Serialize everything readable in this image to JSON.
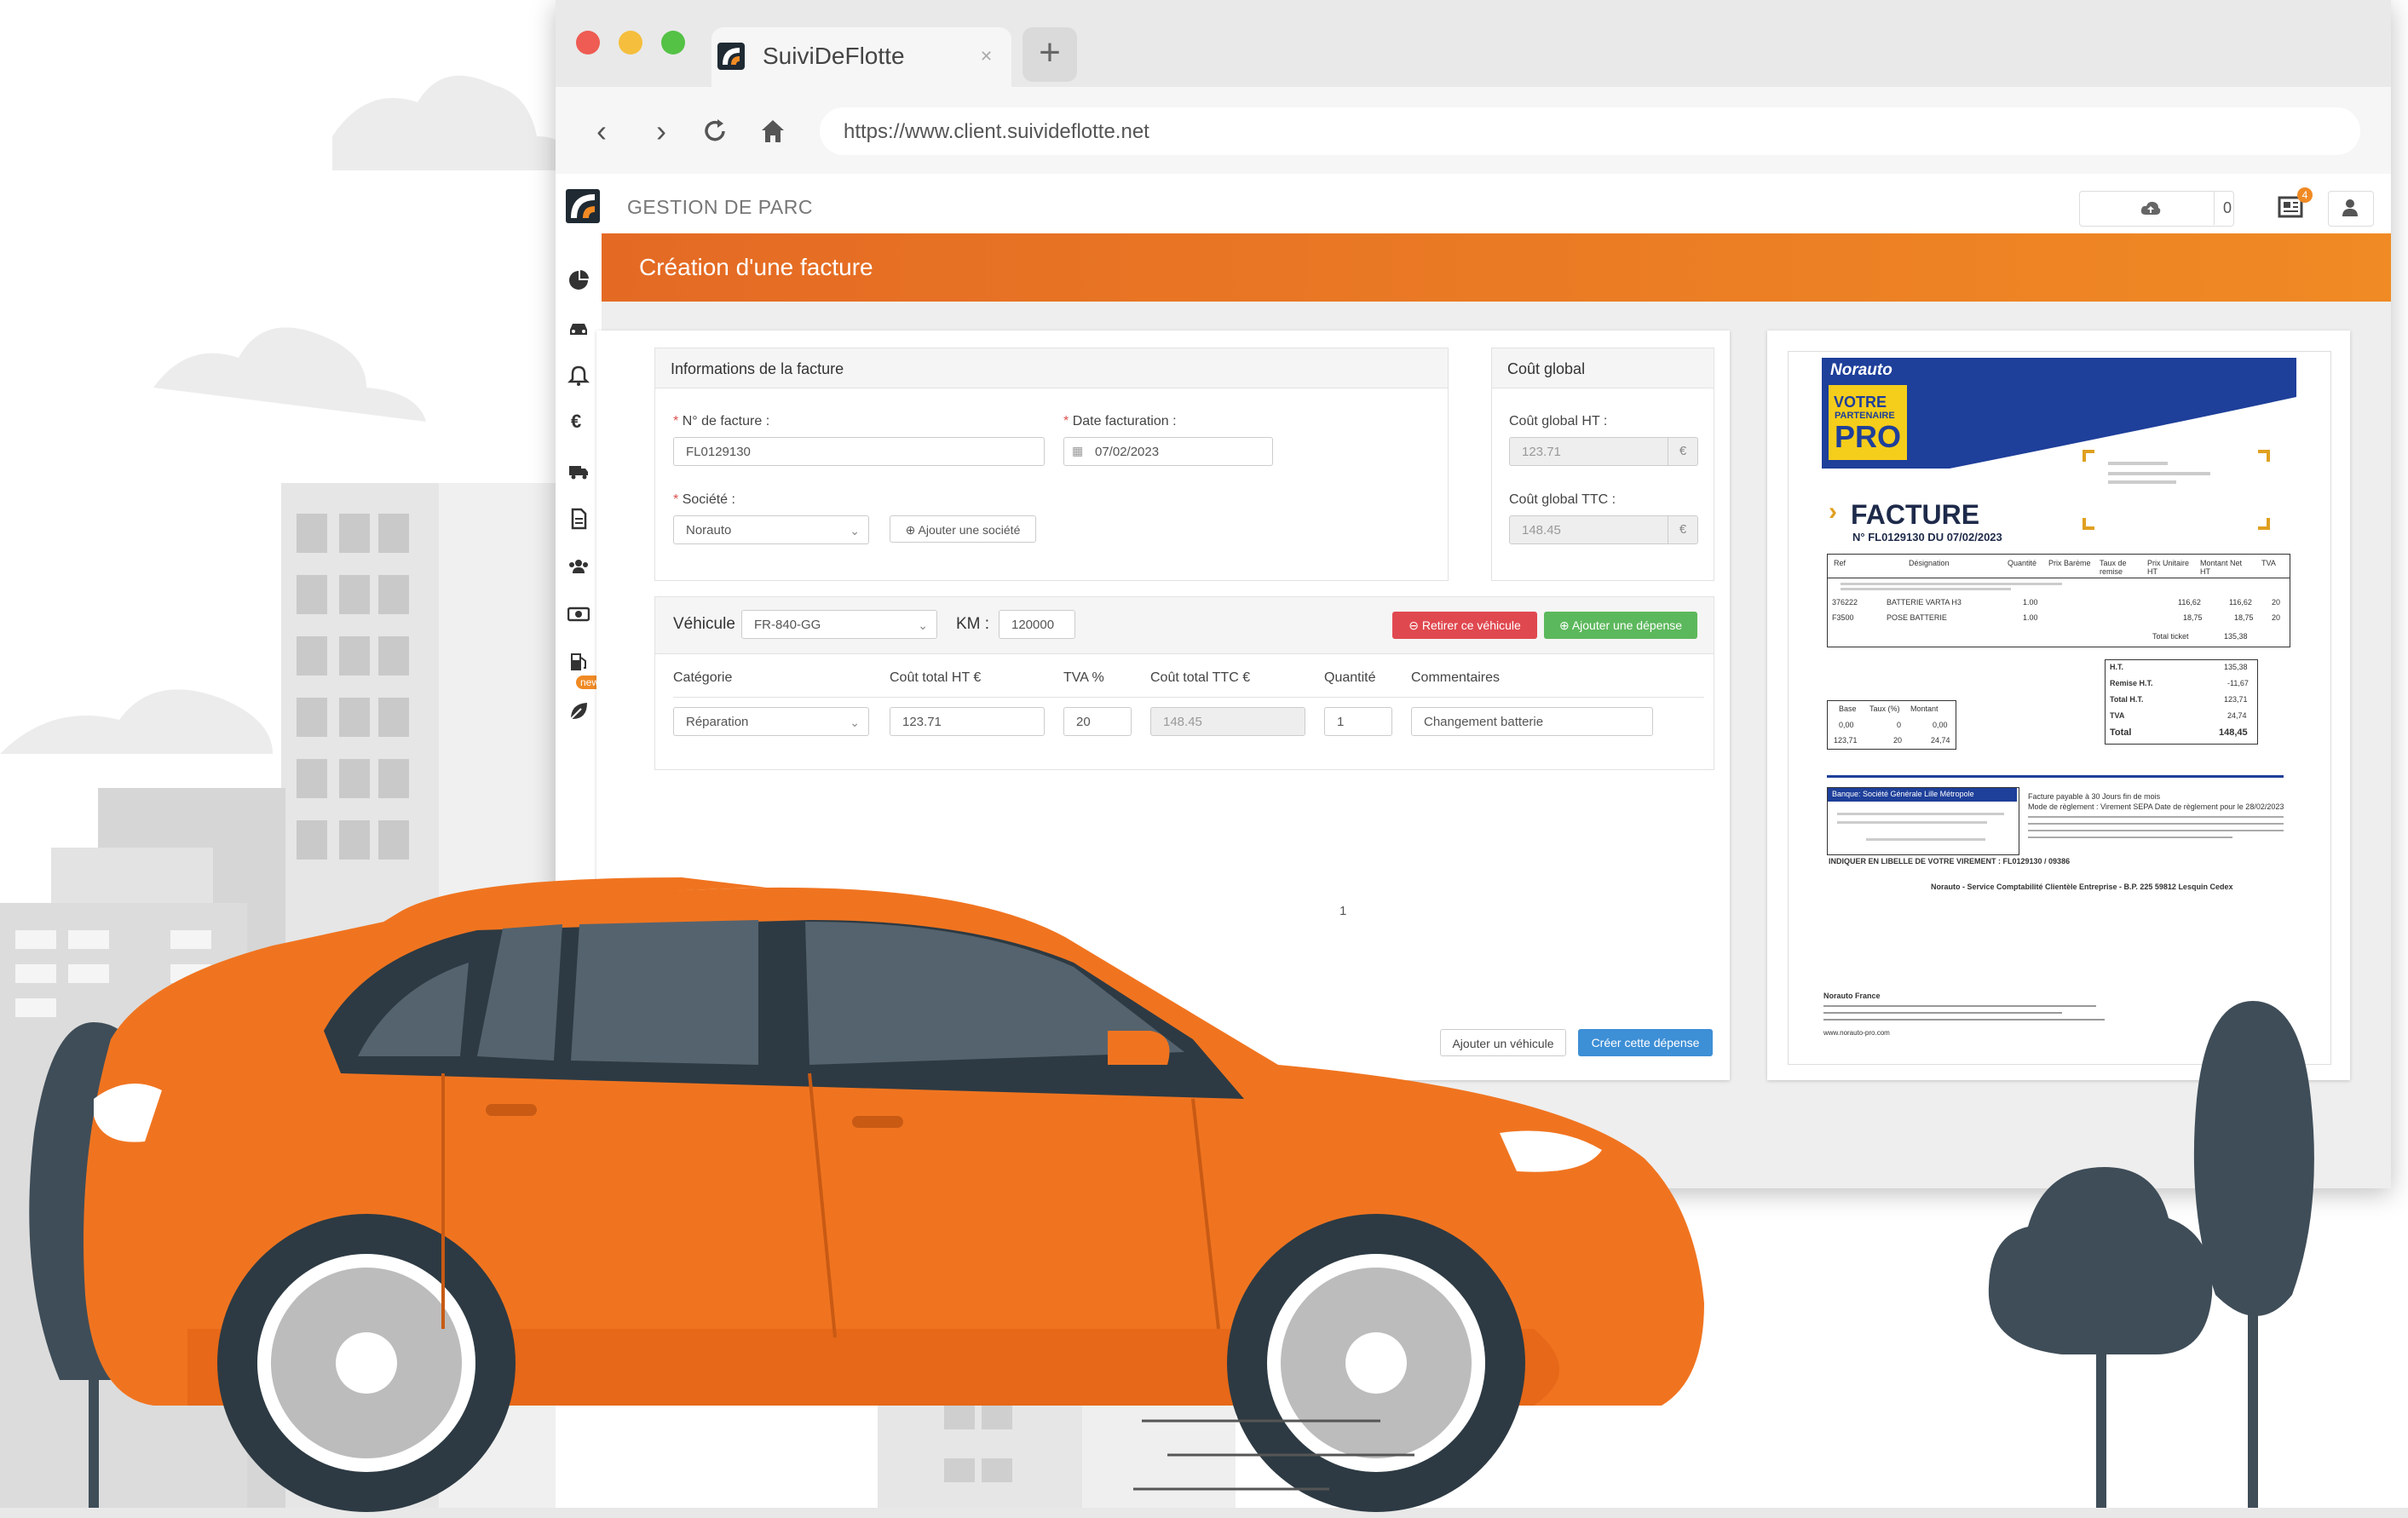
{
  "browser": {
    "tab_title": "SuiviDeFlotte",
    "new_tab_symbol": "+",
    "url": "https://www.client.suivideflotte.net",
    "traffic_colors": [
      "#ee5c53",
      "#f5be3c",
      "#54c245"
    ]
  },
  "header": {
    "title": "GESTION DE PARC",
    "upload_count": "0",
    "notifications_count": "4"
  },
  "sidebar": {
    "icons": [
      "dashboard-icon",
      "car-icon",
      "bell-icon",
      "euro-icon",
      "truck-icon",
      "document-icon",
      "users-icon",
      "money-icon",
      "fuel-icon",
      "leaf-icon"
    ],
    "new_badge": "new"
  },
  "page": {
    "title": "Création d'une facture",
    "accent_color": "#f08a24"
  },
  "invoice_info": {
    "heading": "Informations de la facture",
    "number_label": "N° de facture :",
    "number_value": "FL0129130",
    "date_label": "Date facturation :",
    "date_value": "07/02/2023",
    "company_label": "Société :",
    "company_value": "Norauto",
    "add_company_button": "Ajouter une société",
    "required_mark": "*"
  },
  "global_cost": {
    "heading": "Coût global",
    "ht_label": "Coût global HT :",
    "ht_value": "123.71",
    "ttc_label": "Coût global TTC :",
    "ttc_value": "148.45",
    "currency": "€"
  },
  "vehicle": {
    "label": "Véhicule",
    "value": "FR-840-GG",
    "km_label": "KM :",
    "km_value": "120000",
    "remove_button": "Retirer ce véhicule",
    "add_expense_button": "Ajouter une dépense",
    "columns": [
      "Catégorie",
      "Coût total HT €",
      "TVA %",
      "Coût total TTC €",
      "Quantité",
      "Commentaires"
    ],
    "row": {
      "category": "Réparation",
      "ht": "123.71",
      "tva": "20",
      "ttc": "148.45",
      "qty": "1",
      "comment": "Changement batterie"
    }
  },
  "pagination": "1",
  "actions": {
    "add_vehicle": "Ajouter un véhicule",
    "create_expense": "Créer cette dépense"
  },
  "invoice_doc": {
    "brand": "Norauto",
    "badge_line1": "VOTRE",
    "badge_line2": "PARTENAIRE",
    "badge_line3": "PRO",
    "title": "FACTURE",
    "subtitle": "N° FL0129130 DU 07/02/2023",
    "table_headers": [
      "Ref",
      "Désignation",
      "Quantité",
      "Prix Barème",
      "Taux de remise",
      "Prix Unitaire HT",
      "Montant Net HT",
      "TVA"
    ],
    "lines": [
      {
        "ref": "376222",
        "designation": "BATTERIE VARTA H3",
        "qty": "1.00",
        "unit": "116,62",
        "net": "116,62",
        "tva": "20"
      },
      {
        "ref": "F3500",
        "designation": "POSE BATTERIE",
        "qty": "1.00",
        "unit": "18,75",
        "net": "18,75",
        "tva": "20"
      }
    ],
    "total_ticket_label": "Total ticket",
    "total_ticket": "135,38",
    "totals": [
      {
        "label": "H.T.",
        "value": "135,38"
      },
      {
        "label": "Remise H.T.",
        "value": "-11,67"
      },
      {
        "label": "Total H.T.",
        "value": "123,71"
      },
      {
        "label": "TVA",
        "value": "24,74"
      },
      {
        "label": "Total",
        "value": "148,45"
      }
    ],
    "tax_headers": [
      "Base",
      "Taux (%)",
      "Montant"
    ],
    "tax_rows": [
      [
        "0,00",
        "0",
        "0,00"
      ],
      [
        "123,71",
        "20",
        "24,74"
      ]
    ],
    "bank_label": "Banque: Société Générale Lille Métropole",
    "payment_line1": "Facture payable à 30 Jours fin de mois",
    "payment_line2": "Mode de règlement : Virement SEPA   Date de règlement pour le 28/02/2023",
    "virement_note": "INDIQUER EN LIBELLE DE VOTRE VIREMENT : FL0129130 / 09386",
    "footer": "Norauto - Service Comptabilité Clientèle Entreprise - B.P. 225 59812 Lesquin Cedex",
    "footer_company": "Norauto France",
    "website": "www.norauto-pro.com",
    "brand_color": "#1e3f9a",
    "badge_color": "#f5cd1b"
  },
  "illustration": {
    "car_color": "#f07420",
    "tree_color": "#3f4d58"
  }
}
